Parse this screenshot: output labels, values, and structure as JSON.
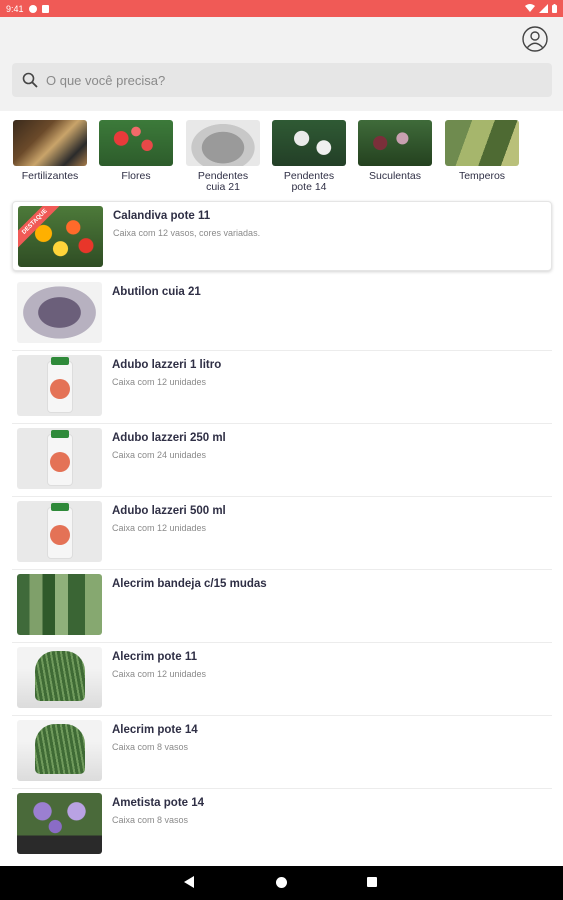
{
  "status_bar": {
    "time": "9:41"
  },
  "search": {
    "placeholder": "O que você precisa?"
  },
  "categories": [
    {
      "label": "Fertilizantes"
    },
    {
      "label": "Flores"
    },
    {
      "label": "Pendentes cuia 21"
    },
    {
      "label": "Pendentes pote 14"
    },
    {
      "label": "Suculentas"
    },
    {
      "label": "Temperos"
    }
  ],
  "badge": {
    "featured": "DESTAQUE"
  },
  "products": [
    {
      "name": "Calandiva pote 11",
      "description": "Caixa com 12 vasos, cores variadas.",
      "featured": true
    },
    {
      "name": "Abutilon cuia 21",
      "description": ""
    },
    {
      "name": "Adubo lazzeri 1 litro",
      "description": "Caixa com 12 unidades"
    },
    {
      "name": "Adubo lazzeri 250 ml",
      "description": "Caixa com 24 unidades"
    },
    {
      "name": "Adubo lazzeri 500 ml",
      "description": "Caixa com 12 unidades"
    },
    {
      "name": "Alecrim bandeja c/15 mudas",
      "description": ""
    },
    {
      "name": "Alecrim pote 11",
      "description": "Caixa com 12 unidades"
    },
    {
      "name": "Alecrim  pote 14",
      "description": "Caixa com 8 vasos"
    },
    {
      "name": "Ametista pote 14",
      "description": "Caixa com 8 vasos"
    }
  ],
  "colors": {
    "accent": "#f05a56",
    "header_bg": "#f2f2f2",
    "text": "#2f2f45"
  },
  "icons": {
    "profile": "user-circle-icon",
    "search": "search-icon"
  }
}
